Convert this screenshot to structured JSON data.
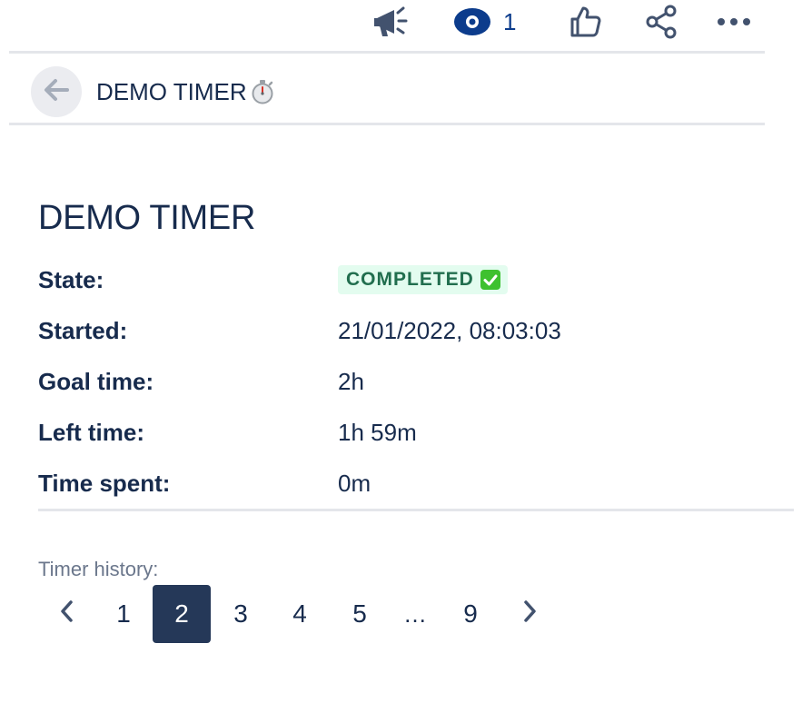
{
  "toolbar": {
    "announce_icon": "megaphone-icon",
    "watch_icon": "eye-icon",
    "watch_count": "1",
    "like_icon": "thumbs-up-icon",
    "share_icon": "share-icon",
    "more_icon": "more-horizontal-icon",
    "colors": {
      "icon": "#42526e",
      "watch": "#0c3c8c"
    }
  },
  "breadcrumb": {
    "back_icon": "arrow-left-icon",
    "title": "DEMO TIMER",
    "title_icon": "stopwatch-icon"
  },
  "main": {
    "heading": "DEMO TIMER",
    "fields": {
      "state": {
        "label": "State:",
        "value": "COMPLETED",
        "value_icon": "check-mark-button-icon"
      },
      "started": {
        "label": "Started:",
        "value": "21/01/2022, 08:03:03"
      },
      "goal": {
        "label": "Goal time:",
        "value": "2h"
      },
      "left": {
        "label": "Left time:",
        "value": "1h 59m"
      },
      "spent": {
        "label": "Time spent:",
        "value": "0m"
      }
    },
    "status_colors": {
      "badge_bg": "#e3fcef",
      "badge_text": "#216e4e"
    }
  },
  "history": {
    "label": "Timer history:",
    "prev_icon": "chevron-left-icon",
    "next_icon": "chevron-right-icon",
    "pages": [
      "1",
      "2",
      "3",
      "4",
      "5",
      "…",
      "9"
    ],
    "current_page": "2",
    "current_color": "#253858"
  }
}
